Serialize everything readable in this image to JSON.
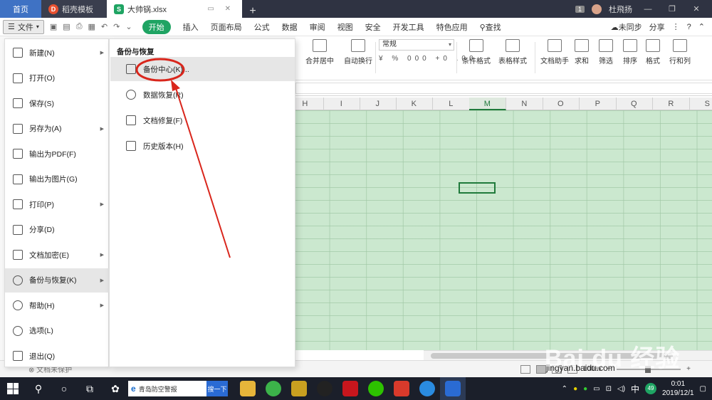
{
  "tabs": {
    "home": "首页",
    "template": "稻壳模板",
    "active_file": "大帅锅.xlsx",
    "add": "+",
    "count_badge": "1",
    "user": "杜飛扬"
  },
  "menu": {
    "file": "文件",
    "start": "开始",
    "items": [
      "插入",
      "页面布局",
      "公式",
      "数据",
      "审阅",
      "视图",
      "安全",
      "开发工具",
      "特色应用"
    ],
    "search": "查找",
    "sync": "未同步",
    "share": "分享"
  },
  "ribbon": {
    "merge": "合并居中",
    "wrap": "自动换行",
    "format_combo": "常规",
    "number_formats": "¥ % 000 +0 .00",
    "cond_format": "条件格式",
    "table_style": "表格样式",
    "doc_helper": "文档助手",
    "sum": "求和",
    "filter": "筛选",
    "sort": "排序",
    "format": "格式",
    "rowcol": "行和列"
  },
  "columns": [
    "H",
    "I",
    "J",
    "K",
    "L",
    "M",
    "N",
    "O",
    "P",
    "Q",
    "R",
    "S"
  ],
  "selected_column": "M",
  "file_menu": [
    {
      "label": "新建(N)",
      "icon": "new-file-icon",
      "arrow": true
    },
    {
      "label": "打开(O)",
      "icon": "folder-open-icon",
      "arrow": false
    },
    {
      "label": "保存(S)",
      "icon": "save-icon",
      "arrow": false
    },
    {
      "label": "另存为(A)",
      "icon": "save-as-icon",
      "arrow": true
    },
    {
      "label": "输出为PDF(F)",
      "icon": "pdf-icon",
      "arrow": false
    },
    {
      "label": "输出为图片(G)",
      "icon": "image-export-icon",
      "arrow": false
    },
    {
      "label": "打印(P)",
      "icon": "print-icon",
      "arrow": true
    },
    {
      "label": "分享(D)",
      "icon": "share-icon",
      "arrow": false
    },
    {
      "label": "文档加密(E)",
      "icon": "lock-icon",
      "arrow": true
    },
    {
      "label": "备份与恢复(K)",
      "icon": "backup-icon",
      "arrow": true
    },
    {
      "label": "帮助(H)",
      "icon": "help-icon",
      "arrow": true
    },
    {
      "label": "选项(L)",
      "icon": "gear-icon",
      "arrow": false
    },
    {
      "label": "退出(Q)",
      "icon": "exit-icon",
      "arrow": false
    }
  ],
  "submenu": {
    "title": "备份与恢复",
    "items": [
      {
        "label": "备份中心(K)...",
        "icon": "backup-center-icon"
      },
      {
        "label": "数据恢复(R)",
        "icon": "restore-icon"
      },
      {
        "label": "文档修复(F)",
        "icon": "repair-icon"
      },
      {
        "label": "历史版本(H)",
        "icon": "history-icon"
      }
    ]
  },
  "status": {
    "protect": "文档未保护",
    "zoom": "100%"
  },
  "watermark": {
    "brand": "Bai du 经验",
    "url": "jingyan.baidu.com"
  },
  "taskbar": {
    "search_text": "青岛防空警报",
    "search_go": "搜一下",
    "ime": "中",
    "notify_count": "49",
    "time": "0:01",
    "date": "2019/12/1"
  }
}
